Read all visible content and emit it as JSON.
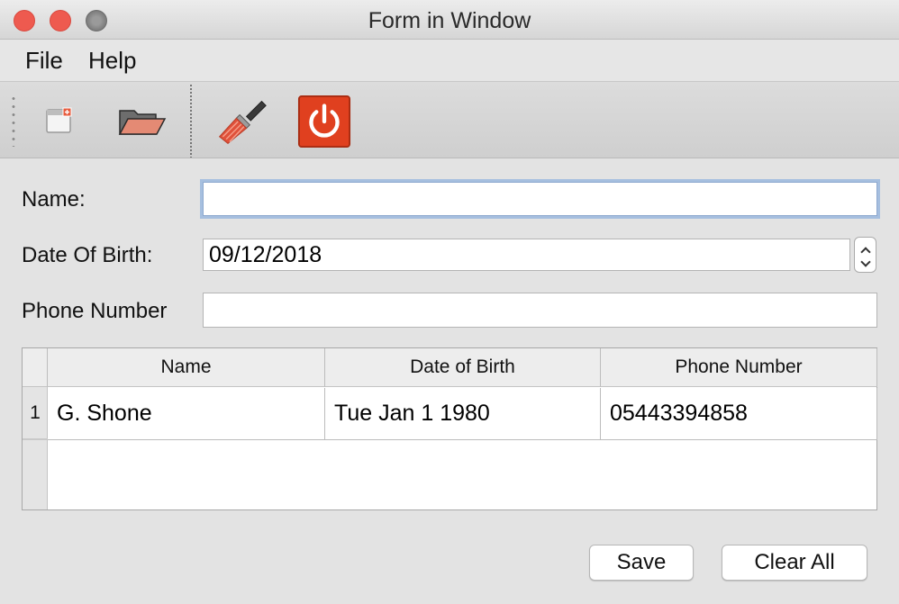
{
  "window": {
    "title": "Form in Window"
  },
  "menubar": {
    "items": [
      {
        "label": "File"
      },
      {
        "label": "Help"
      }
    ]
  },
  "toolbar": {
    "tools": [
      {
        "icon": "new-window-icon"
      },
      {
        "icon": "open-folder-icon"
      },
      {
        "icon": "clear-brush-icon"
      },
      {
        "icon": "power-icon"
      }
    ]
  },
  "form": {
    "name_label": "Name:",
    "name_value": "",
    "dob_label": "Date Of Birth:",
    "dob_value": "09/12/2018",
    "phone_label": "Phone Number",
    "phone_value": ""
  },
  "table": {
    "columns": [
      "Name",
      "Date of Birth",
      "Phone Number"
    ],
    "rows": [
      {
        "num": "1",
        "cells": [
          "G. Shone",
          "Tue Jan 1 1980",
          "05443394858"
        ]
      }
    ]
  },
  "buttons": {
    "save_label": "Save",
    "clear_label": "Clear All"
  },
  "colors": {
    "close": "#ee5a4f",
    "focus_ring": "#a6bfdf",
    "power_button": "#e0401f"
  }
}
